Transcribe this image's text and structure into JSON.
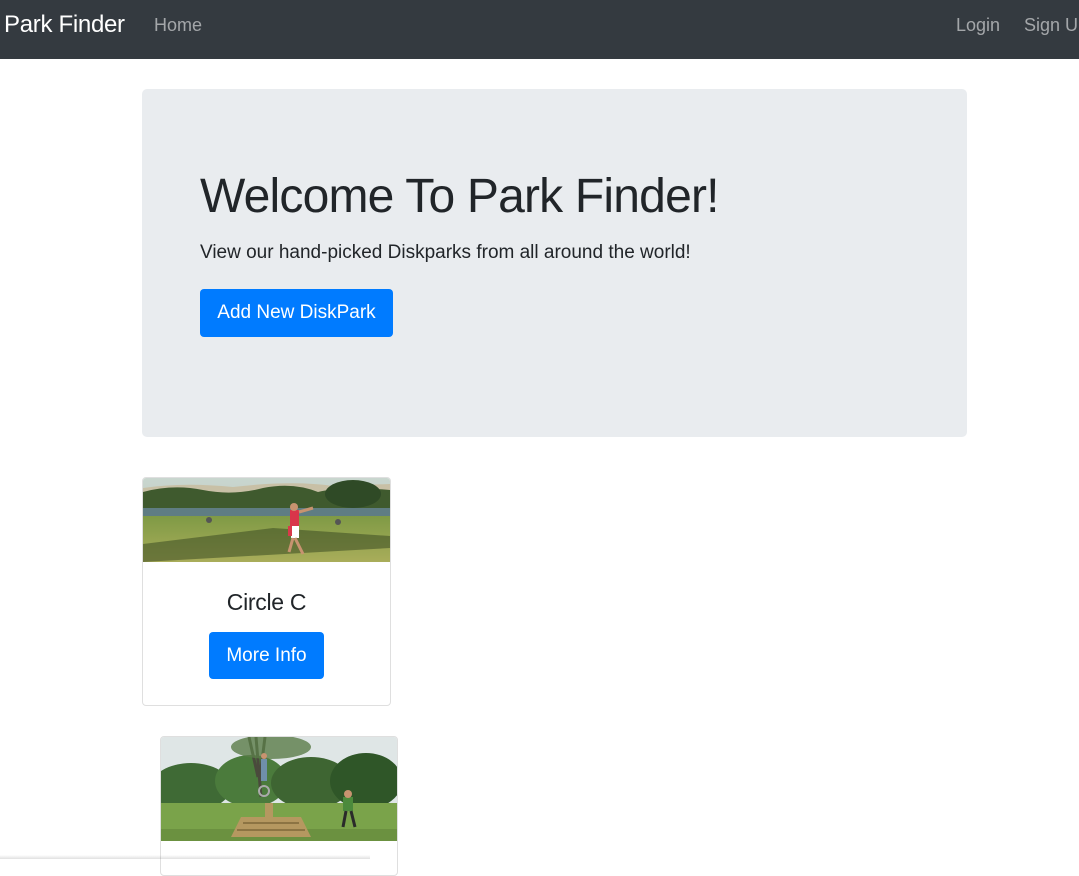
{
  "navbar": {
    "brand": "Park Finder",
    "home": "Home",
    "login": "Login",
    "signup": "Sign Up"
  },
  "jumbotron": {
    "title": "Welcome To Park Finder!",
    "lead": "View our hand-picked Diskparks from all around the world!",
    "add_button": "Add New DiskPark"
  },
  "parks": [
    {
      "name": "Circle C",
      "button": "More Info",
      "image": "disc-golf-riverside-photo"
    },
    {
      "image": "disc-golf-basket-trees-photo"
    }
  ],
  "colors": {
    "navbar_bg": "#343a40",
    "jumbotron_bg": "#e9ecef",
    "primary": "#007bff"
  }
}
